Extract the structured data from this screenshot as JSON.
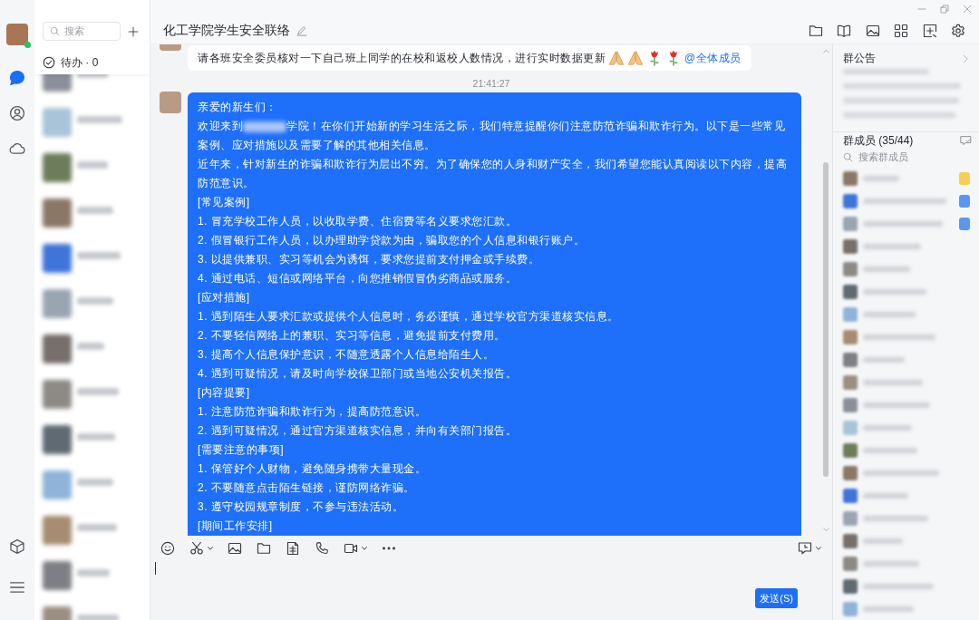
{
  "rail": {
    "online": true,
    "nav": [
      {
        "selected": true
      },
      {
        "selected": false
      },
      {
        "selected": false
      }
    ]
  },
  "chat_list": {
    "search": {
      "placeholder": "搜索"
    },
    "todo": "待办 · 0",
    "items": [
      {
        "kind": "blurred"
      },
      {
        "kind": "blurred"
      },
      {
        "kind": "blurred"
      },
      {
        "kind": "blurred"
      },
      {
        "kind": "blurred"
      },
      {
        "kind": "blurred"
      },
      {
        "kind": "blurred"
      },
      {
        "kind": "blurred"
      },
      {
        "kind": "blurred"
      },
      {
        "kind": "blurred"
      },
      {
        "kind": "blurred"
      },
      {
        "kind": "blurred"
      },
      {
        "kind": "blurred"
      }
    ]
  },
  "window": {
    "title": "化工学院学生安全联络"
  },
  "messages": [
    {
      "kind": "bubble",
      "selected": false,
      "text": "请各班安全委员核对一下自己班上同学的在校和返校人数情况，进行实时数据更新",
      "emojis": [
        {
          "kind": "hands"
        },
        {
          "kind": "hands"
        },
        {
          "kind": "rose"
        },
        {
          "kind": "rose"
        }
      ],
      "mention": "@全体成员"
    },
    {
      "kind": "time",
      "text": "21:41:27"
    },
    {
      "kind": "bubble",
      "selected": true,
      "paragraphs": [
        {
          "kind": "text",
          "text": "亲爱的新生们："
        },
        {
          "kind": "redacted",
          "before": "欢迎来到",
          "after": "学院！在你们开始新的学习生活之际，我们特意提醒你们注意防范诈骗和欺诈行为。以下是一些常见",
          "next_line": "案例、应对措施以及需要了解的其他相关信息。"
        },
        {
          "kind": "text",
          "text": "近年来，针对新生的诈骗和欺诈行为层出不穷。为了确保您的人身和财产安全，我们希望您能认真阅读以下内容，提高防范意识。"
        },
        {
          "kind": "heading",
          "text": "[常见案例]"
        },
        {
          "kind": "item",
          "text": "1. 冒充学校工作人员，以收取学费、住宿费等名义要求您汇款。"
        },
        {
          "kind": "item",
          "text": "2. 假冒银行工作人员，以办理助学贷款为由，骗取您的个人信息和银行账户。"
        },
        {
          "kind": "item",
          "text": "3. 以提供兼职、实习等机会为诱饵，要求您提前支付押金或手续费。"
        },
        {
          "kind": "item",
          "text": "4. 通过电话、短信或网络平台，向您推销假冒伪劣商品或服务。"
        },
        {
          "kind": "heading",
          "text": "[应对措施]"
        },
        {
          "kind": "item",
          "text": "1. 遇到陌生人要求汇款或提供个人信息时，务必谨慎，通过学校官方渠道核实信息。"
        },
        {
          "kind": "item",
          "text": "2. 不要轻信网络上的兼职、实习等信息，避免提前支付费用。"
        },
        {
          "kind": "item",
          "text": "3. 提高个人信息保护意识，不随意透露个人信息给陌生人。"
        },
        {
          "kind": "item",
          "text": "4. 遇到可疑情况，请及时向学校保卫部门或当地公安机关报告。"
        },
        {
          "kind": "heading",
          "text": "[内容提要]"
        },
        {
          "kind": "item",
          "text": "1. 注意防范诈骗和欺诈行为，提高防范意识。"
        },
        {
          "kind": "item",
          "text": "2. 遇到可疑情况，通过官方渠道核实信息，并向有关部门报告。"
        },
        {
          "kind": "heading",
          "text": "[需要注意的事项]"
        },
        {
          "kind": "item",
          "text": "1. 保管好个人财物，避免随身携带大量现金。"
        },
        {
          "kind": "item",
          "text": "2. 不要随意点击陌生链接，谨防网络诈骗。"
        },
        {
          "kind": "item",
          "text": "3. 遵守校园规章制度，不参与违法活动。"
        },
        {
          "kind": "heading",
          "text": "[期间工作安排]"
        }
      ]
    }
  ],
  "composer": {
    "send": "发送(S)"
  },
  "announcement": {
    "title": "群公告",
    "lines": [
      {
        "kind": "blurred"
      },
      {
        "kind": "blurred"
      },
      {
        "kind": "blurred"
      },
      {
        "kind": "blurred"
      }
    ]
  },
  "members": {
    "title": "群成员 (35/44)",
    "search": {
      "placeholder": "搜索群成员"
    },
    "items": [
      {
        "kind": "blurred",
        "color": "#f6cf52"
      },
      {
        "kind": "blurred",
        "color": "#5b97f2"
      },
      {
        "kind": "blurred",
        "color": "#5b97f2"
      },
      {
        "kind": "blurred"
      },
      {
        "kind": "blurred"
      },
      {
        "kind": "blurred"
      },
      {
        "kind": "blurred"
      },
      {
        "kind": "blurred"
      },
      {
        "kind": "blurred"
      },
      {
        "kind": "blurred"
      },
      {
        "kind": "blurred"
      },
      {
        "kind": "blurred"
      },
      {
        "kind": "blurred"
      },
      {
        "kind": "blurred"
      },
      {
        "kind": "blurred"
      },
      {
        "kind": "blurred"
      },
      {
        "kind": "blurred"
      },
      {
        "kind": "blurred"
      },
      {
        "kind": "blurred"
      },
      {
        "kind": "blurred"
      }
    ]
  }
}
